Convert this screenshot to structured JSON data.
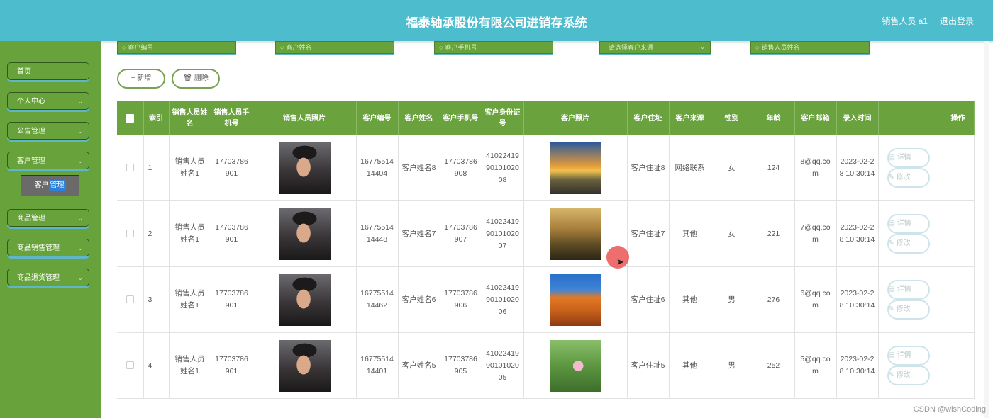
{
  "header": {
    "title": "福泰轴承股份有限公司进销存系统",
    "user": "销售人员 a1",
    "logout": "退出登录"
  },
  "sidebar": {
    "items": [
      {
        "label": "首页",
        "chevron": ""
      },
      {
        "label": "个人中心",
        "chevron": "⌄"
      },
      {
        "label": "公告管理",
        "chevron": "⌄"
      },
      {
        "label": "客户管理",
        "chevron": "⌄"
      },
      {
        "label": "商品管理",
        "chevron": "⌄"
      },
      {
        "label": "商品销售管理",
        "chevron": "⌄"
      },
      {
        "label": "商品退货管理",
        "chevron": "⌄"
      }
    ],
    "submenu": {
      "label_a": "客户",
      "label_b": "管理"
    }
  },
  "search": {
    "customer_no": "客户编号",
    "customer_name": "客户姓名",
    "customer_phone": "客户手机号",
    "customer_source": "请选择客户来源",
    "sales_name": "销售人员姓名"
  },
  "toolbar": {
    "add": "+ 新增",
    "delete": "🗑 删除"
  },
  "table": {
    "headers": [
      "索引",
      "销售人员姓名",
      "销售人员手机号",
      "销售人员照片",
      "客户编号",
      "客户姓名",
      "客户手机号",
      "客户身份证号",
      "客户照片",
      "客户住址",
      "客户来源",
      "性别",
      "年龄",
      "客户邮箱",
      "录入时间",
      "操作"
    ],
    "rows": [
      {
        "index": "1",
        "sales_name": "销售人员姓名1",
        "sales_phone": "17703786901",
        "cust_no": "1677551414404",
        "cust_name": "客户姓名8",
        "cust_phone": "17703786908",
        "id_no": "410224199010102008",
        "address": "客户住址8",
        "source": "网络联系",
        "gender": "女",
        "age": "124",
        "email": "8@qq.com",
        "time": "2023-02-28 10:30:14"
      },
      {
        "index": "2",
        "sales_name": "销售人员姓名1",
        "sales_phone": "17703786901",
        "cust_no": "1677551414448",
        "cust_name": "客户姓名7",
        "cust_phone": "17703786907",
        "id_no": "410224199010102007",
        "address": "客户住址7",
        "source": "其他",
        "gender": "女",
        "age": "221",
        "email": "7@qq.com",
        "time": "2023-02-28 10:30:14"
      },
      {
        "index": "3",
        "sales_name": "销售人员姓名1",
        "sales_phone": "17703786901",
        "cust_no": "1677551414462",
        "cust_name": "客户姓名6",
        "cust_phone": "17703786906",
        "id_no": "410224199010102006",
        "address": "客户住址6",
        "source": "其他",
        "gender": "男",
        "age": "276",
        "email": "6@qq.com",
        "time": "2023-02-28 10:30:14"
      },
      {
        "index": "4",
        "sales_name": "销售人员姓名1",
        "sales_phone": "17703786901",
        "cust_no": "1677551414401",
        "cust_name": "客户姓名5",
        "cust_phone": "17703786905",
        "id_no": "410224199010102005",
        "address": "客户住址5",
        "source": "其他",
        "gender": "男",
        "age": "252",
        "email": "5@qq.com",
        "time": "2023-02-28 10:30:14"
      }
    ],
    "actions": {
      "detail": "▤ 详情",
      "edit": "✎ 修改"
    }
  },
  "watermark": "CSDN @wishCoding"
}
